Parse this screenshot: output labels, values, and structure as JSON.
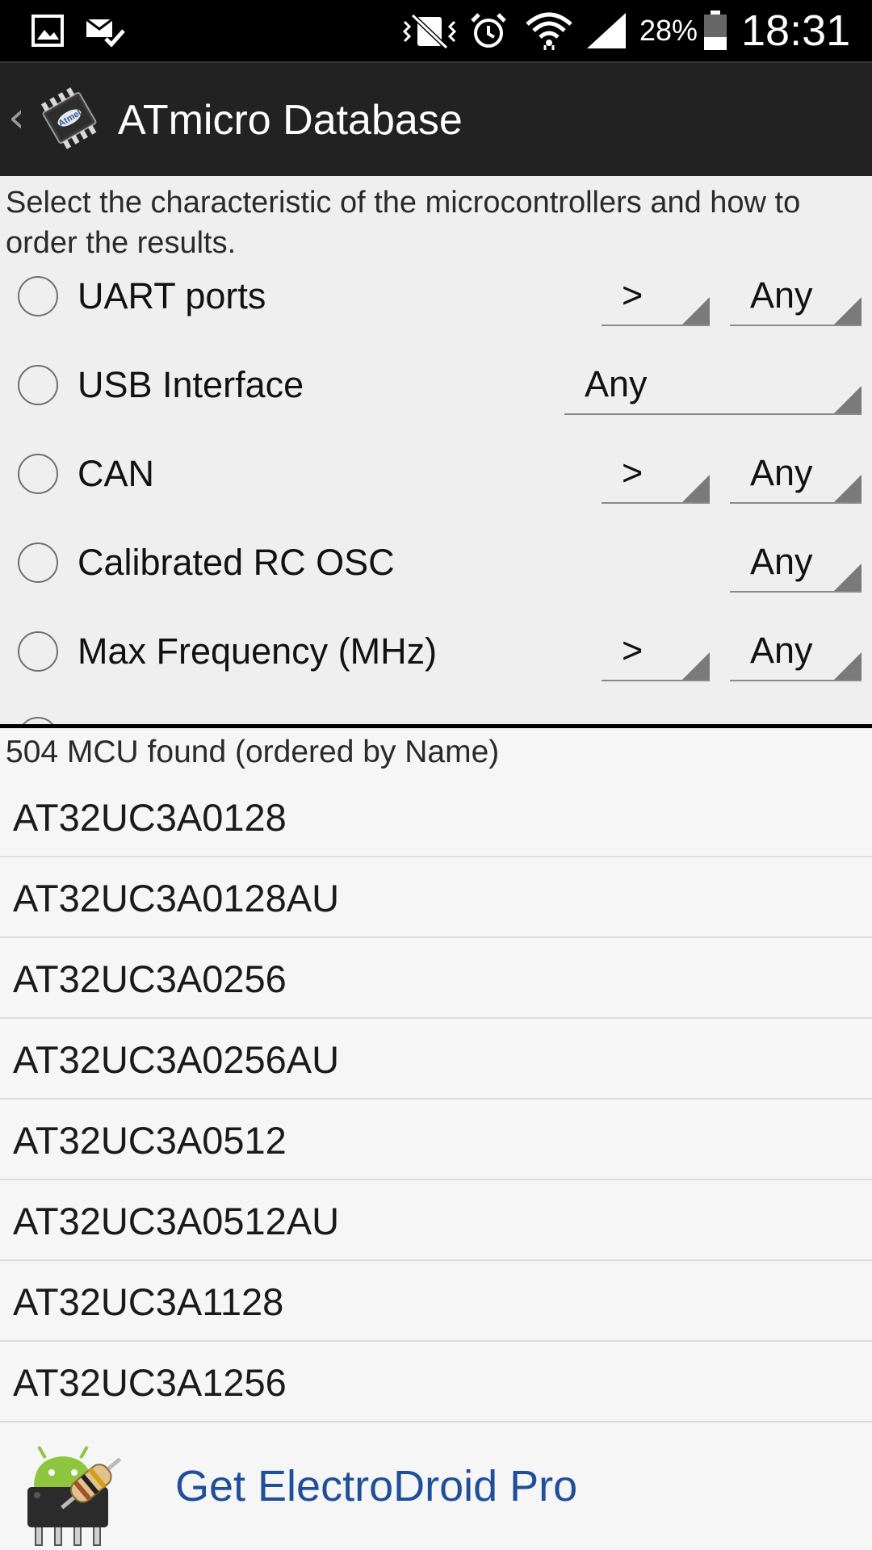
{
  "status_bar": {
    "icons": [
      "gallery-icon",
      "mail-done-icon",
      "vibrate-icon",
      "alarm-icon",
      "wifi-icon",
      "signal-icon",
      "battery-icon"
    ],
    "battery": "28%",
    "time": "18:31"
  },
  "action_bar": {
    "title": "ATmicro Database",
    "logo_text": "Atmel"
  },
  "filter": {
    "instructions": "Select the characteristic of the microcontrollers and how to order the results.",
    "rows": [
      {
        "label": "UART ports",
        "operator": ">",
        "value": "Any"
      },
      {
        "label": "USB Interface",
        "value": "Any"
      },
      {
        "label": "CAN",
        "operator": ">",
        "value": "Any"
      },
      {
        "label": "Calibrated RC OSC",
        "value": "Any"
      },
      {
        "label": "Max Frequency (MHz)",
        "operator": ">",
        "value": "Any"
      }
    ]
  },
  "results": {
    "header": "504 MCU found (ordered by Name)",
    "items": [
      "AT32UC3A0128",
      "AT32UC3A0128AU",
      "AT32UC3A0256",
      "AT32UC3A0256AU",
      "AT32UC3A0512",
      "AT32UC3A0512AU",
      "AT32UC3A1128",
      "AT32UC3A1256"
    ]
  },
  "promo": {
    "text": "Get ElectroDroid Pro"
  },
  "colors": {
    "status_bar_bg": "#000000",
    "action_bar_bg": "#222222",
    "panel_bg": "#efefef",
    "promo_text": "#1f4e9a"
  }
}
